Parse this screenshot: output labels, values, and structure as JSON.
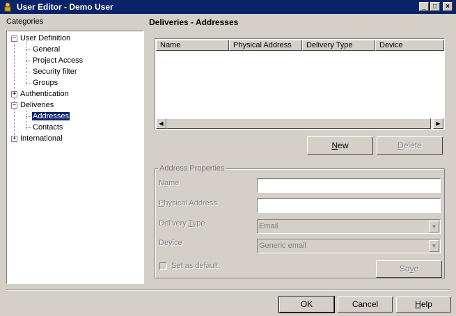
{
  "window": {
    "title": "User Editor - Demo User",
    "controls": {
      "minimize": "_",
      "maximize": "□",
      "close": "×"
    }
  },
  "categories_label": "Categories",
  "tree": {
    "user_definition": "User Definition",
    "general": "General",
    "project_access": "Project Access",
    "security_filter": "Security filter",
    "groups": "Groups",
    "authentication": "Authentication",
    "deliveries": "Deliveries",
    "addresses": "Addresses",
    "contacts": "Contacts",
    "international": "International",
    "expanded_sign": "−",
    "collapsed_sign": "+"
  },
  "section_title": "Deliveries - Addresses",
  "list": {
    "columns": [
      "Name",
      "Physical Address",
      "Delivery Type",
      "Device"
    ],
    "rows": []
  },
  "buttons": {
    "new": {
      "first": "N",
      "rest": "ew"
    },
    "delete": {
      "first": "D",
      "rest": "elete"
    },
    "save": {
      "pre": "Sa",
      "ul": "v",
      "post": "e"
    },
    "ok": "OK",
    "cancel": "Cancel",
    "help": {
      "first": "H",
      "rest": "elp"
    }
  },
  "address_properties": {
    "title": "Address Properties",
    "name_label": {
      "pre": "N",
      "ul": "a",
      "post": "me"
    },
    "name_value": "",
    "physical_label": {
      "ul": "P",
      "post": "hysical Address"
    },
    "physical_value": "",
    "delivery_type_label": {
      "pre": "Delivery ",
      "ul": "T",
      "post": "ype"
    },
    "delivery_type_value": "Email",
    "device_label": {
      "pre": "De",
      "ul": "v",
      "post": "ice"
    },
    "device_value": "Generic email",
    "set_default_label": {
      "ul": "S",
      "post": "et as default"
    },
    "set_default_checked": false
  }
}
